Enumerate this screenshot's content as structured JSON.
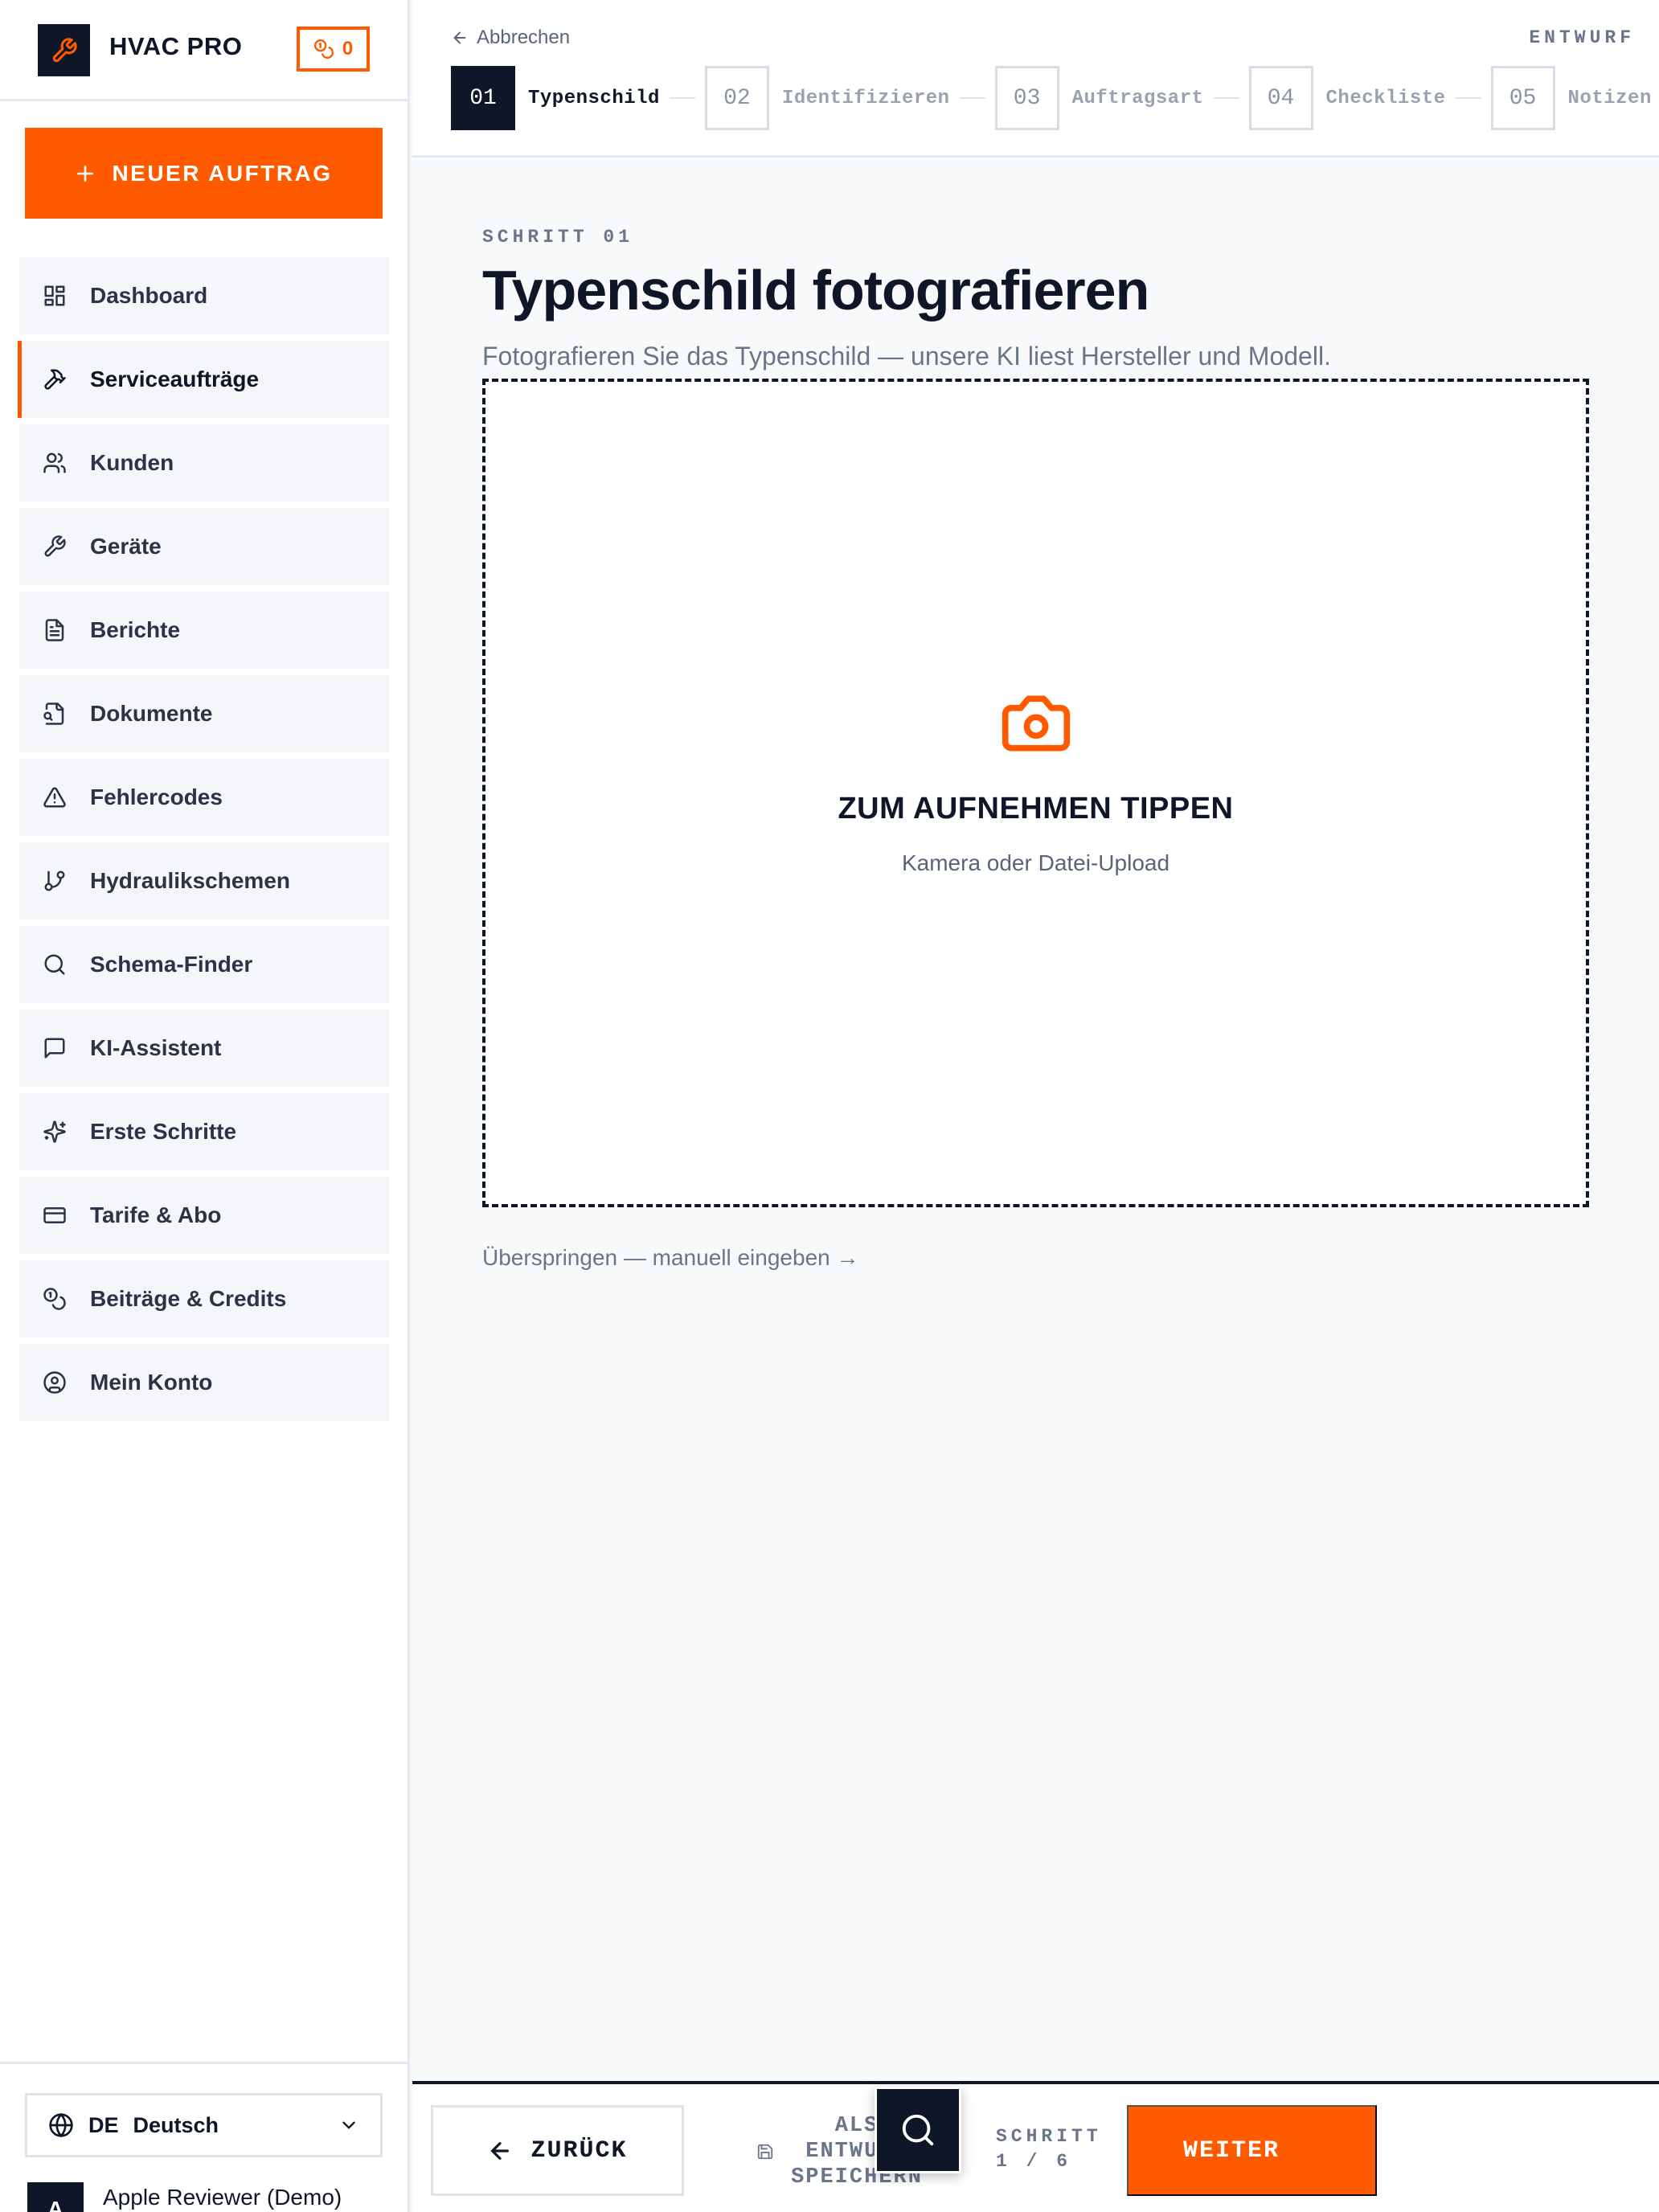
{
  "app": {
    "name": "HVAC PRO",
    "credits": "0"
  },
  "sidebar": {
    "new_order_label": "NEUER AUFTRAG",
    "items": [
      {
        "label": "Dashboard",
        "icon": "dashboard-icon"
      },
      {
        "label": "Serviceaufträge",
        "icon": "hammer-icon",
        "active": true
      },
      {
        "label": "Kunden",
        "icon": "users-icon"
      },
      {
        "label": "Geräte",
        "icon": "wrench-icon"
      },
      {
        "label": "Berichte",
        "icon": "file-text-icon"
      },
      {
        "label": "Dokumente",
        "icon": "file-search-icon"
      },
      {
        "label": "Fehlercodes",
        "icon": "alert-triangle-icon"
      },
      {
        "label": "Hydraulikschemen",
        "icon": "git-branch-icon"
      },
      {
        "label": "Schema-Finder",
        "icon": "search-icon"
      },
      {
        "label": "KI-Assistent",
        "icon": "message-square-icon"
      },
      {
        "label": "Erste Schritte",
        "icon": "sparkles-icon"
      },
      {
        "label": "Tarife & Abo",
        "icon": "credit-card-icon"
      },
      {
        "label": "Beiträge & Credits",
        "icon": "coins-icon"
      },
      {
        "label": "Mein Konto",
        "icon": "user-circle-icon"
      }
    ],
    "language": {
      "code": "DE",
      "name": "Deutsch"
    },
    "user": {
      "initial": "A",
      "name": "Apple Reviewer (Demo)"
    }
  },
  "topbar": {
    "cancel_label": "Abbrechen",
    "status_label": "ENTWURF",
    "steps": [
      {
        "num": "01",
        "label": "Typenschild",
        "active": true
      },
      {
        "num": "02",
        "label": "Identifizieren"
      },
      {
        "num": "03",
        "label": "Auftragsart"
      },
      {
        "num": "04",
        "label": "Checkliste"
      },
      {
        "num": "05",
        "label": "Notizen"
      }
    ]
  },
  "main": {
    "eyebrow": "SCHRITT 01",
    "title": "Typenschild fotografieren",
    "subtitle": "Fotografieren Sie das Typenschild — unsere KI liest Hersteller und Modell.",
    "upload_title": "ZUM AUFNEHMEN TIPPEN",
    "upload_hint": "Kamera oder Datei-Upload",
    "skip_label": "Überspringen — manuell eingeben →"
  },
  "footer": {
    "back_label": "ZURÜCK",
    "draft_label": "ALS ENTWURF SPEICHERN",
    "step_counter_label": "SCHRITT",
    "step_counter_value": "1 / 6",
    "next_label": "WEITER"
  },
  "colors": {
    "accent": "#ff5a00",
    "dark": "#0f1628",
    "muted": "#6b7589",
    "border": "#e3e7ee"
  }
}
